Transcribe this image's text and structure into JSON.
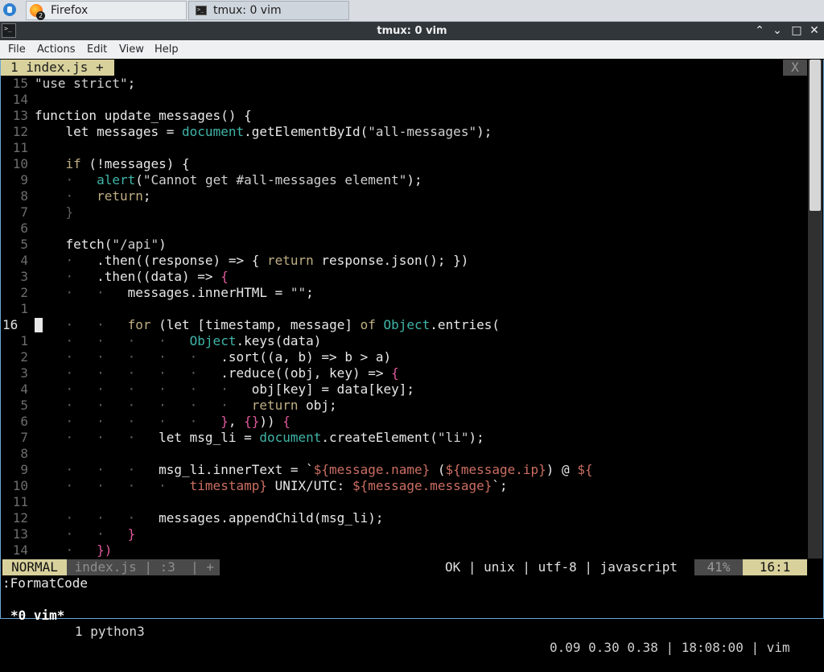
{
  "taskbar": {
    "tasks": [
      {
        "label": "Firefox",
        "badge": "2"
      },
      {
        "label": "tmux: 0 vim"
      }
    ]
  },
  "window": {
    "title": "tmux: 0 vim"
  },
  "menubar": [
    "File",
    "Actions",
    "Edit",
    "View",
    "Help"
  ],
  "vim": {
    "tab_label": "1 index.js +",
    "tab_close": "X",
    "lines": [
      {
        "num": "15",
        "html": "<span class=\"s\">\"use strict\"</span>;"
      },
      {
        "num": "14",
        "html": ""
      },
      {
        "num": "13",
        "html": "<span class=\"y\">function</span> update_messages() {"
      },
      {
        "num": "12",
        "html": "    <span class=\"y\">let</span> messages = <span class=\"t\">document</span>.getElementById(<span class=\"s\">\"all-messages\"</span>);"
      },
      {
        "num": "11",
        "html": ""
      },
      {
        "num": "10",
        "html": "    <span class=\"k\">if</span> (!messages) {"
      },
      {
        "num": "9",
        "html": "<span class=\"g\">    ·   </span><span class=\"t\">alert</span>(<span class=\"s\">\"Cannot get #all-messages element\"</span>);"
      },
      {
        "num": "8",
        "html": "<span class=\"g\">    ·   </span><span class=\"k\">return</span>;"
      },
      {
        "num": "7",
        "html": "    <span class=\"g\">}</span>"
      },
      {
        "num": "6",
        "html": ""
      },
      {
        "num": "5",
        "html": "    fetch(<span class=\"s\">\"/api\"</span>)"
      },
      {
        "num": "4",
        "html": "<span class=\"g\">    ·   </span>.then((response) =&gt; { <span class=\"k\">return</span> response.json(); })"
      },
      {
        "num": "3",
        "html": "<span class=\"g\">    ·   </span>.then((data) =&gt; <span class=\"p\">{</span>"
      },
      {
        "num": "2",
        "html": "<span class=\"g\">    ·   ·   </span>messages.innerHTML = <span class=\"s\">\"\"</span>;"
      },
      {
        "num": "1",
        "html": ""
      },
      {
        "num": "16",
        "cur": true,
        "html": "<span class=\"g\">    ·   ·   </span><span class=\"k\">for</span> (<span class=\"y\">let</span> [timestamp, message] <span class=\"k\">of</span> <span class=\"t\">Object</span>.entries("
      },
      {
        "num": "1",
        "html": "<span class=\"g\">    ·   ·   ·   ·   </span><span class=\"t\">Object</span>.keys(data)"
      },
      {
        "num": "2",
        "html": "<span class=\"g\">    ·   ·   ·   ·   ·   </span>.sort((a, b) =&gt; b &gt; a)"
      },
      {
        "num": "3",
        "html": "<span class=\"g\">    ·   ·   ·   ·   ·   </span>.reduce((obj, key) =&gt; <span class=\"p\">{</span>"
      },
      {
        "num": "4",
        "html": "<span class=\"g\">    ·   ·   ·   ·   ·   ·   </span>obj[key] = data[key];"
      },
      {
        "num": "5",
        "html": "<span class=\"g\">    ·   ·   ·   ·   ·   ·   </span><span class=\"k\">return</span> obj;"
      },
      {
        "num": "6",
        "html": "<span class=\"g\">    ·   ·   ·   ·   ·   </span><span class=\"p\">}</span>, <span class=\"p\">{}</span>)) <span class=\"p\">{</span>"
      },
      {
        "num": "7",
        "html": "<span class=\"g\">    ·   ·   ·   </span><span class=\"y\">let</span> msg_li = <span class=\"t\">document</span>.createElement(<span class=\"s\">\"li\"</span>);"
      },
      {
        "num": "8",
        "html": ""
      },
      {
        "num": "9",
        "html": "<span class=\"g\">    ·   ·   ·   </span>msg_li.innerText = `<span class=\"r\">${message.name}</span> (<span class=\"r\">${message.ip}</span>) @ <span class=\"r\">${</span>"
      },
      {
        "num": "10",
        "html": "<span class=\"g\">    ·   ·   ·   ·   </span><span class=\"r\">timestamp}</span> UNIX/UTC: <span class=\"r\">${message.message}</span>`;"
      },
      {
        "num": "11",
        "html": ""
      },
      {
        "num": "12",
        "html": "<span class=\"g\">    ·   ·   ·   </span>messages.appendChild(msg_li);"
      },
      {
        "num": "13",
        "html": "<span class=\"g\">    ·   ·   </span><span class=\"p\">}</span>"
      },
      {
        "num": "14",
        "html": "<span class=\"g\">    ·   </span><span class=\"p\">})</span>"
      }
    ],
    "status": {
      "mode": "NORMAL",
      "file": " index.js | :3  | +",
      "right": "OK | unix | utf-8 | javascript",
      "percent": "41%",
      "position": "16:1"
    },
    "cmdline": ":FormatCode",
    "scroll_fraction": 0.41
  },
  "tmux": {
    "active_window": "*0 vim*",
    "other_window": "1 python3",
    "right": "0.09 0.30 0.38 | 18:08:00 | vim"
  }
}
